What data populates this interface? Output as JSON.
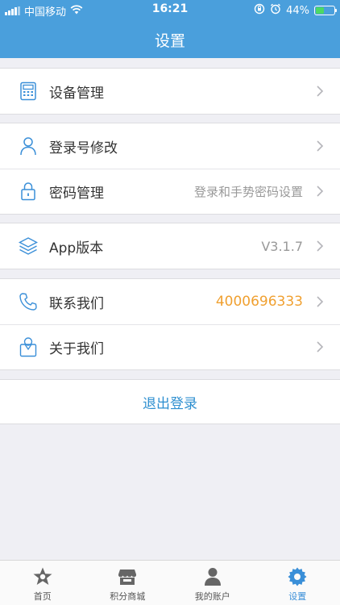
{
  "status_bar": {
    "carrier": "中国移动",
    "time": "16:21",
    "battery": "44%",
    "battery_level": 0.44,
    "icons": [
      "signal-icon",
      "wifi-icon",
      "rotation-lock-icon",
      "alarm-icon",
      "battery-icon"
    ]
  },
  "header": {
    "title": "设置"
  },
  "colors": {
    "header_bg": "#4a9fdc",
    "icon_blue": "#3a8fd8",
    "phone_orange": "#f0a030"
  },
  "settings": {
    "device": {
      "label": "设备管理",
      "icon": "calculator-icon"
    },
    "login_id": {
      "label": "登录号修改",
      "icon": "user-icon"
    },
    "password": {
      "label": "密码管理",
      "value": "登录和手势密码设置",
      "icon": "lock-icon"
    },
    "version": {
      "label": "App版本",
      "value": "V3.1.7",
      "icon": "layers-icon"
    },
    "contact": {
      "label": "联系我们",
      "value": "4000696333",
      "icon": "phone-icon"
    },
    "about": {
      "label": "关于我们",
      "icon": "profile-icon"
    }
  },
  "logout": {
    "label": "退出登录"
  },
  "tabbar": {
    "tabs": [
      {
        "label": "首页",
        "icon": "home-star-icon",
        "active": false
      },
      {
        "label": "积分商城",
        "icon": "store-icon",
        "active": false
      },
      {
        "label": "我的账户",
        "icon": "person-icon",
        "active": false
      },
      {
        "label": "设置",
        "icon": "gear-icon",
        "active": true
      }
    ]
  }
}
